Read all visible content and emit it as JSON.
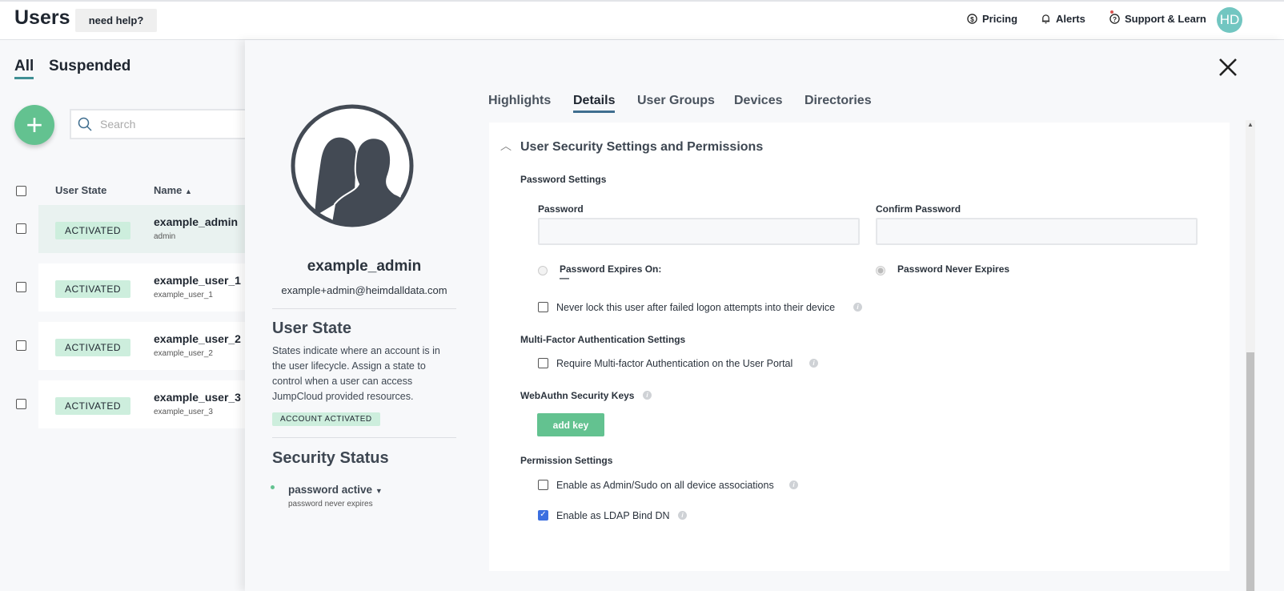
{
  "header": {
    "title": "Users",
    "help": "need help?",
    "nav": [
      "Pricing",
      "Alerts",
      "Support & Learn"
    ],
    "avatar": "HD"
  },
  "list": {
    "tabs": [
      "All",
      "Suspended"
    ],
    "search_placeholder": "Search",
    "columns": [
      "User State",
      "Name"
    ],
    "rows": [
      {
        "state": "ACTIVATED",
        "name": "example_admin",
        "sub": "admin"
      },
      {
        "state": "ACTIVATED",
        "name": "example_user_1",
        "sub": "example_user_1"
      },
      {
        "state": "ACTIVATED",
        "name": "example_user_2",
        "sub": "example_user_2"
      },
      {
        "state": "ACTIVATED",
        "name": "example_user_3",
        "sub": "example_user_3"
      }
    ]
  },
  "profile": {
    "name": "example_admin",
    "email": "example+admin@heimdalldata.com",
    "state_title": "User State",
    "state_desc": "States indicate where an account is in the user lifecycle. Assign a state to control when a user can access JumpCloud provided resources.",
    "state_badge": "ACCOUNT ACTIVATED",
    "security_title": "Security Status",
    "password_status": "password active",
    "password_sub": "password never expires"
  },
  "tabs": [
    "Highlights",
    "Details",
    "User Groups",
    "Devices",
    "Directories"
  ],
  "details": {
    "section": "User Security Settings and Permissions",
    "password_settings": "Password Settings",
    "password": "Password",
    "confirm": "Confirm Password",
    "expires_on": "Password Expires On:",
    "expires_value": "—",
    "never_expires": "Password Never Expires",
    "never_lock": "Never lock this user after failed logon attempts into their device",
    "mfa_title": "Multi-Factor Authentication Settings",
    "mfa": "Require Multi-factor Authentication on the User Portal",
    "webauthn": "WebAuthn Security Keys",
    "add_key": "add key",
    "perm_title": "Permission Settings",
    "admin_sudo": "Enable as Admin/Sudo on all device associations",
    "ldap": "Enable as LDAP Bind DN",
    "ldap_checked": true,
    "admin_checked": false,
    "mfa_checked": false,
    "never_lock_checked": false
  }
}
